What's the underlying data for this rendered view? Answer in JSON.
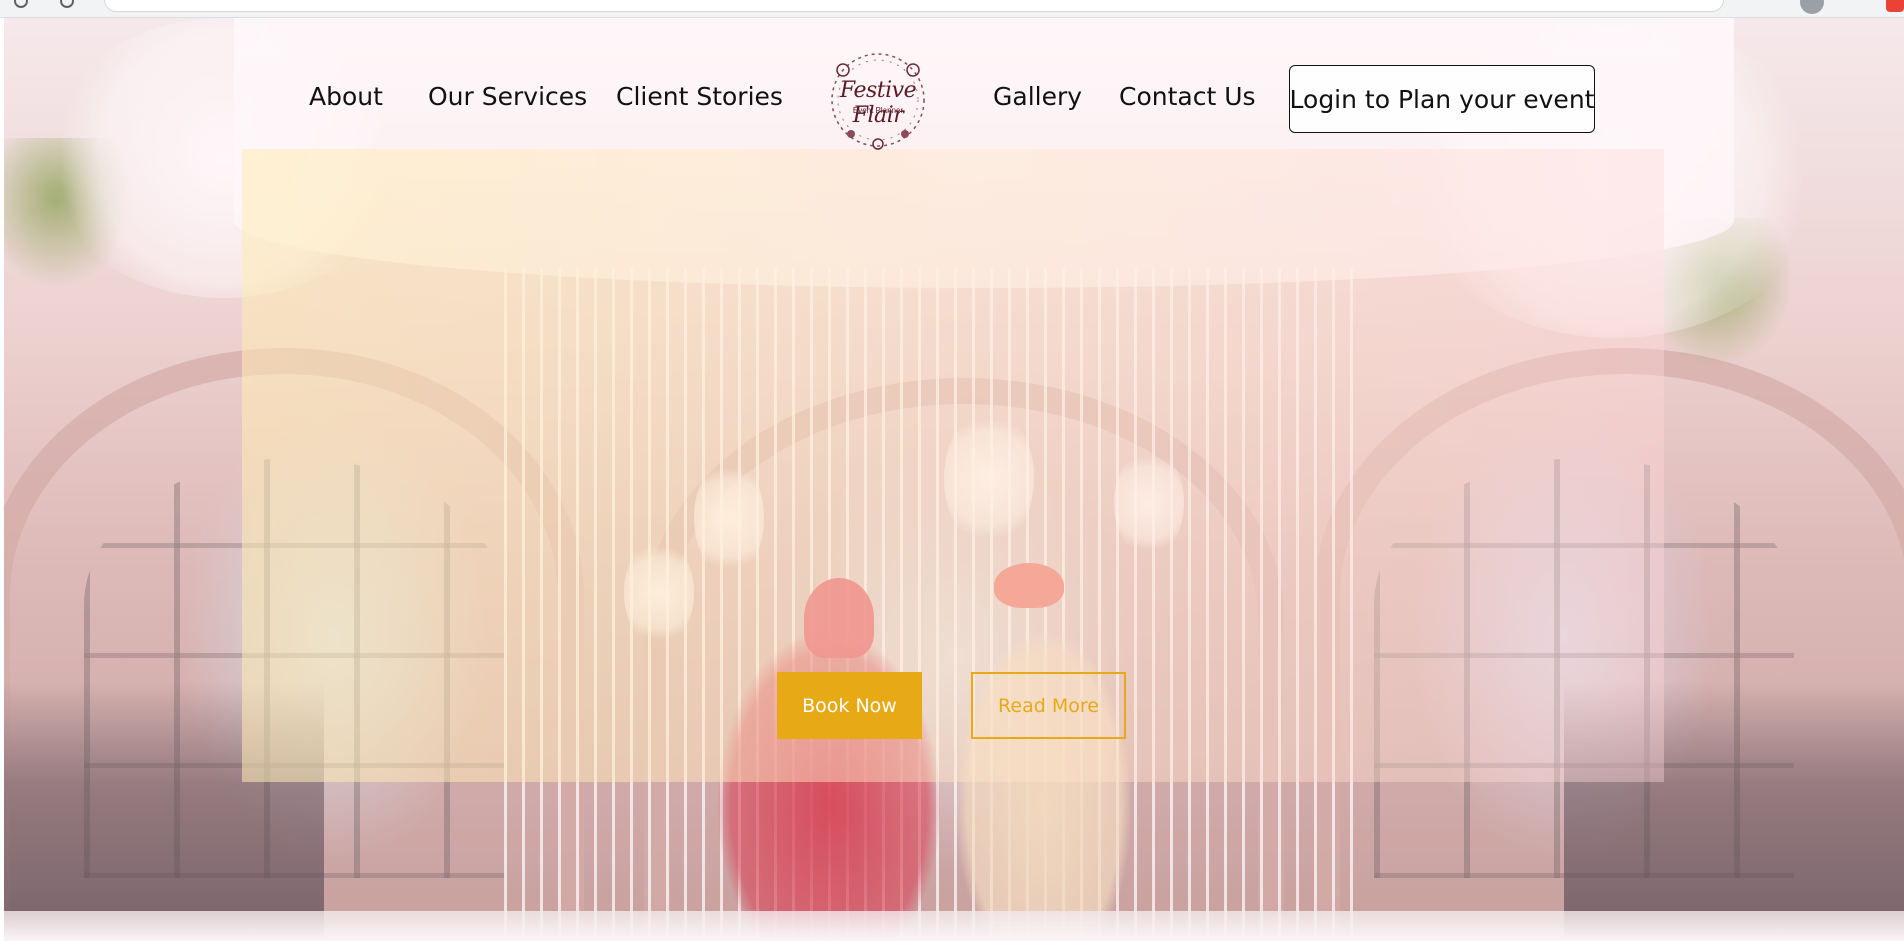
{
  "nav": {
    "links": [
      {
        "label": "About"
      },
      {
        "label": "Our Services"
      },
      {
        "label": "Client Stories"
      },
      {
        "label": "Gallery"
      },
      {
        "label": "Contact Us"
      }
    ],
    "logo": {
      "title": "Festive Flair",
      "subtitle": "Event Planner",
      "icon": "floral-wreath-logo"
    },
    "login_button": "Login to Plan your event"
  },
  "hero": {
    "image": "wedding-ceremony-photo",
    "book_now": "Book Now",
    "read_more": "Read More"
  },
  "colors": {
    "accent": "#e8a917",
    "logo": "#5a1a28",
    "text": "#111111"
  }
}
